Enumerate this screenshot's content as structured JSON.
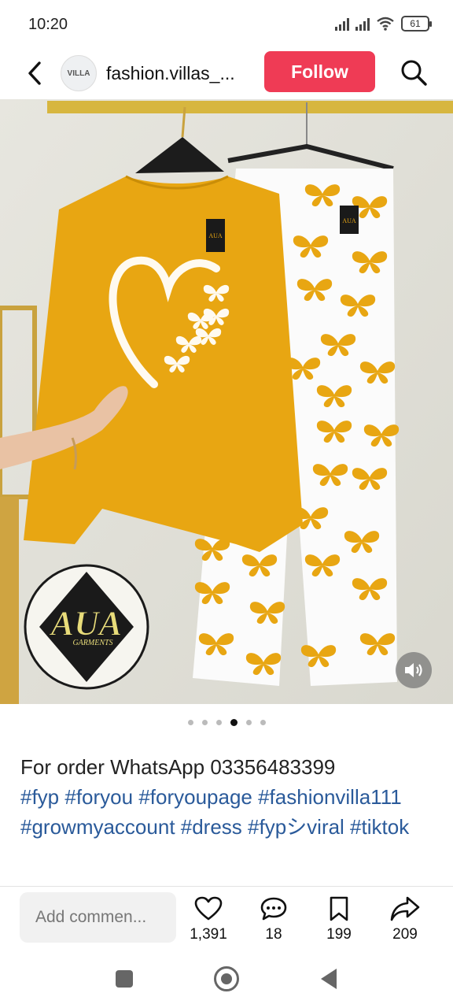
{
  "status_bar": {
    "time": "10:20",
    "battery": "61"
  },
  "header": {
    "back_icon": "back-arrow-icon",
    "avatar_text": "VILLA",
    "username": "fashion.villas_...",
    "follow_label": "Follow",
    "search_icon": "search-icon"
  },
  "post": {
    "logo_text": "AUA",
    "logo_subtext": "GARMENTS",
    "tag_text": "AUA",
    "carousel": {
      "total": 6,
      "active_index": 3
    }
  },
  "caption": {
    "line1": "For order WhatsApp 03356483399",
    "hashtags": "#fyp #foryou #foryoupage #fashionvilla111 #growmyaccount #dress #fypシviral #tiktok"
  },
  "actions": {
    "comment_placeholder": "Add commen...",
    "likes": "1,391",
    "comments": "18",
    "saves": "199",
    "shares": "209"
  },
  "colors": {
    "follow": "#ef3b55",
    "hashtag": "#2a5a9a",
    "mustard": "#e8a612"
  }
}
